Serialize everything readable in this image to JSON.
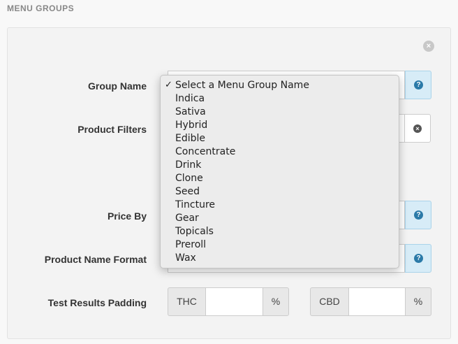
{
  "section": {
    "title": "MENU GROUPS"
  },
  "panel": {
    "close_icon": "×"
  },
  "labels": {
    "group_name": "Group Name",
    "product_filters": "Product Filters",
    "price_by": "Price By",
    "product_name_format": "Product Name Format",
    "test_results_padding": "Test Results Padding"
  },
  "icons": {
    "help": "?",
    "clear": "×"
  },
  "test_results": {
    "thc_label": "THC",
    "thc_unit": "%",
    "thc_value": "",
    "cbd_label": "CBD",
    "cbd_unit": "%",
    "cbd_value": ""
  },
  "dropdown": {
    "checkmark": "✓",
    "selected": "Select a Menu Group Name",
    "options": [
      "Select a Menu Group Name",
      "Indica",
      "Sativa",
      "Hybrid",
      "Edible",
      "Concentrate",
      "Drink",
      "Clone",
      "Seed",
      "Tincture",
      "Gear",
      "Topicals",
      "Preroll",
      "Wax"
    ]
  },
  "colors": {
    "help_bg": "#d7ecf7",
    "help_icon": "#2b7aa8",
    "panel_bg": "#f3f3f3"
  }
}
